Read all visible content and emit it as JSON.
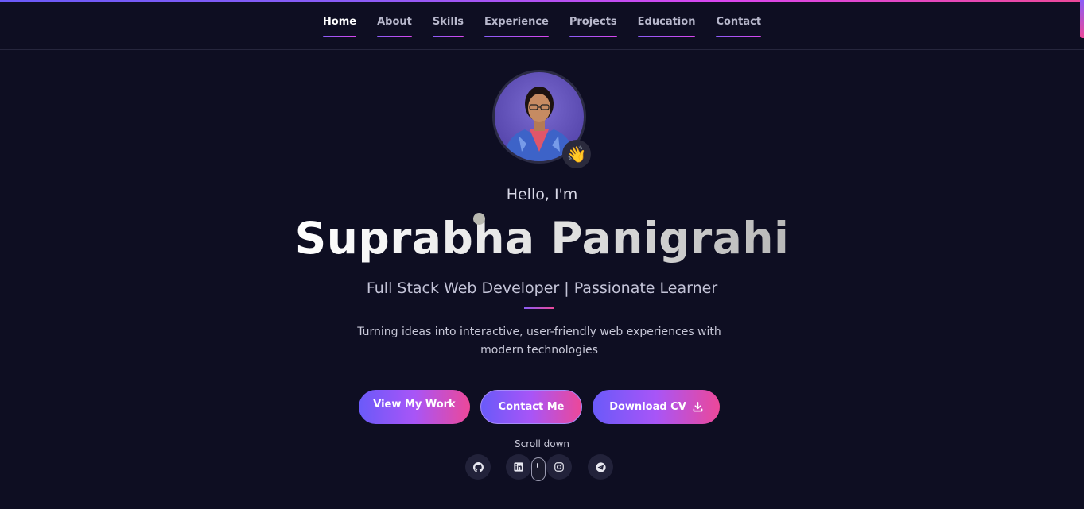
{
  "nav": {
    "items": [
      {
        "label": "Home",
        "active": true
      },
      {
        "label": "About"
      },
      {
        "label": "Skills"
      },
      {
        "label": "Experience"
      },
      {
        "label": "Projects"
      },
      {
        "label": "Education"
      },
      {
        "label": "Contact"
      }
    ]
  },
  "hero": {
    "wave_emoji": "👋",
    "greeting": "Hello, I'm",
    "name": "Suprabha Panigrahi",
    "subtitle": "Full Stack Web Developer | Passionate Learner",
    "description": "Turning ideas into interactive, user-friendly web experiences with modern technologies"
  },
  "buttons": {
    "view_work": "View My Work",
    "contact": "Contact Me",
    "download_cv": "Download CV"
  },
  "scroll_hint": "Scroll down",
  "social": [
    {
      "icon": "github-icon"
    },
    {
      "icon": "linkedin-icon"
    },
    {
      "icon": "instagram-icon"
    },
    {
      "icon": "telegram-icon"
    }
  ],
  "colors": {
    "background": "#0e0e22",
    "accent_start": "#6a5af9",
    "accent_mid": "#a855f7",
    "accent_end": "#ec4899"
  }
}
